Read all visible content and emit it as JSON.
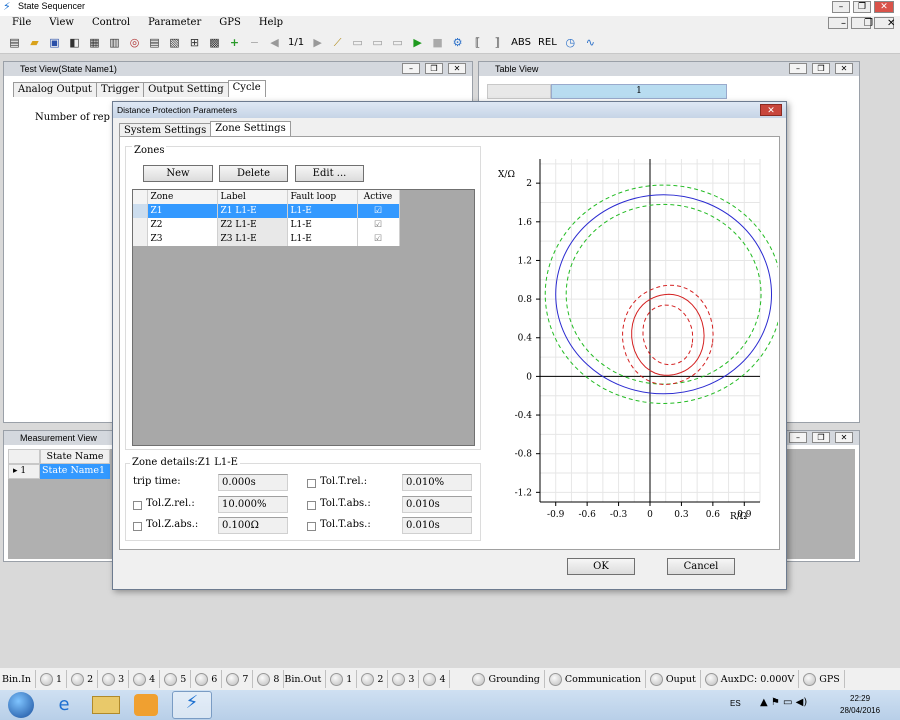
{
  "app": {
    "title": "State Sequencer"
  },
  "menu": [
    "File",
    "View",
    "Control",
    "Parameter",
    "GPS",
    "Help"
  ],
  "toolbar": {
    "page": "1/1",
    "abs": "ABS",
    "rel": "REL"
  },
  "test_view": {
    "title": "Test View(State Name1)",
    "tabs": [
      "Analog Output",
      "Trigger",
      "Output Setting",
      "Cycle"
    ],
    "body_text": "Number of rep"
  },
  "table_view": {
    "title": "Table View",
    "col": "1"
  },
  "measurement_view": {
    "title": "Measurement View",
    "header": "State Name",
    "row_num": "1",
    "row_val": "State Name1"
  },
  "dialog": {
    "title": "Distance Protection Parameters",
    "tabs": [
      "System Settings",
      "Zone Settings"
    ],
    "zones_group": "Zones",
    "buttons": {
      "new": "New",
      "delete": "Delete",
      "edit": "Edit ..."
    },
    "columns": [
      "Zone",
      "Label",
      "Fault loop",
      "Active"
    ],
    "rows": [
      {
        "zone": "Z1",
        "label": "Z1 L1-E",
        "loop": "L1-E",
        "active": true,
        "selected": true
      },
      {
        "zone": "Z2",
        "label": "Z2 L1-E",
        "loop": "L1-E",
        "active": true,
        "selected": false
      },
      {
        "zone": "Z3",
        "label": "Z3 L1-E",
        "loop": "L1-E",
        "active": true,
        "selected": false
      }
    ],
    "zone_details": {
      "title": "Zone details:Z1 L1-E",
      "trip_time_label": "trip time:",
      "trip_time": "0.000s",
      "tol_z_rel_label": "Tol.Z.rel.:",
      "tol_z_rel": "10.000%",
      "tol_z_abs_label": "Tol.Z.abs.:",
      "tol_z_abs": "0.100Ω",
      "tol_t_rel_label": "Tol.T.rel.:",
      "tol_t_rel": "0.010%",
      "tol_t_abs_label": "Tol.T.abs.:",
      "tol_t_abs_1": "0.010s",
      "tol_t_abs_2_label": "Tol.T.abs.:",
      "tol_t_abs_2": "0.010s"
    },
    "ok": "OK",
    "cancel": "Cancel"
  },
  "chart_data": {
    "type": "scatter",
    "xlabel": "R/Ω",
    "ylabel": "X/Ω",
    "x_ticks": [
      "-0.9",
      "-0.6",
      "-0.3",
      "0",
      "0.3",
      "0.6",
      "0.9"
    ],
    "y_ticks": [
      "2",
      "1.6",
      "1.2",
      "0.8",
      "0.4",
      "0",
      "-0.4",
      "-0.8",
      "-1.2"
    ],
    "xlim": [
      -1.05,
      1.05
    ],
    "ylim": [
      -1.3,
      2.25
    ],
    "grid": true,
    "series": [
      {
        "shape": "circle",
        "style": "solid",
        "color": "#2a2ad0",
        "cx": 0.13,
        "cy": 0.85,
        "r": 1.03
      },
      {
        "shape": "circle",
        "style": "dashed",
        "color": "#22bb22",
        "cx": 0.13,
        "cy": 0.85,
        "r": 1.13
      },
      {
        "shape": "circle",
        "style": "dashed",
        "color": "#22bb22",
        "cx": 0.13,
        "cy": 0.85,
        "r": 0.93
      },
      {
        "shape": "blob",
        "style": "solid",
        "color": "#d42020",
        "cx": 0.17,
        "cy": 0.43,
        "rx": 0.32,
        "ry": 0.45
      },
      {
        "shape": "blob",
        "style": "dashed",
        "color": "#d42020",
        "cx": 0.17,
        "cy": 0.43,
        "rx": 0.4,
        "ry": 0.55
      },
      {
        "shape": "blob",
        "style": "dashed",
        "color": "#d42020",
        "cx": 0.17,
        "cy": 0.43,
        "rx": 0.22,
        "ry": 0.33
      }
    ]
  },
  "status": {
    "bin_in": "Bin.In",
    "bin_in_items": [
      "1",
      "2",
      "3",
      "4",
      "5",
      "6",
      "7",
      "8"
    ],
    "bin_out": "Bin.Out",
    "bin_out_items": [
      "1",
      "2",
      "3",
      "4"
    ],
    "grounding": "Grounding",
    "communication": "Communication",
    "output": "Ouput",
    "auxdc": "AuxDC: 0.000V",
    "gps": "GPS"
  },
  "taskbar": {
    "lang": "ES",
    "time": "22:29",
    "date": "28/04/2016"
  }
}
